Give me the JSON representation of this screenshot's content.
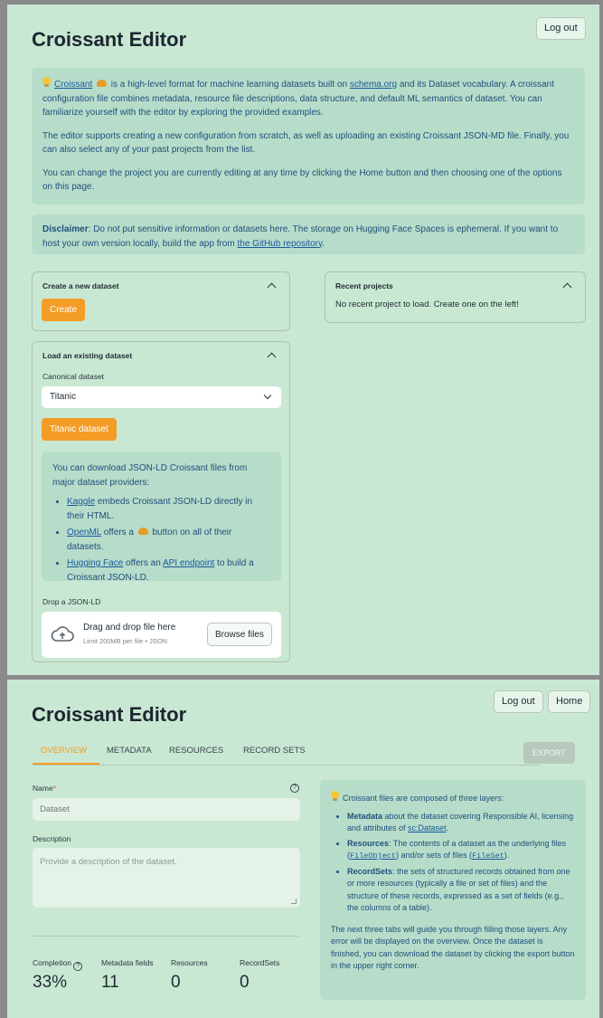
{
  "screen1": {
    "title": "Croissant Editor",
    "logout_label": "Log out",
    "intro": {
      "p1_link_croissant": "Croissant",
      "p1_a": " is a high-level format for machine learning datasets built on ",
      "p1_link_schema": "schema.org",
      "p1_b": " and its Dataset vocabulary. A croissant configuration file combines metadata, resource file descriptions, data structure, and default ML semantics of dataset. You can familiarize yourself with the editor by exploring the provided examples.",
      "p2": "The editor supports creating a new configuration from scratch, as well as uploading an existing Croissant JSON-MD file. Finally, you can also select any of your past projects from the list.",
      "p3": "You can change the project you are currently editing at any time by clicking the Home button and then choosing one of the options on this page."
    },
    "disclaimer": {
      "bold": "Disclaimer",
      "text": ": Do not put sensitive information or datasets here. The storage on Hugging Face Spaces is ephemeral. If you want to host your own version locally, build the app from ",
      "link": "the GitHub repository",
      "end": "."
    },
    "create_card": {
      "title": "Create a new dataset",
      "button": "Create"
    },
    "recent_card": {
      "title": "Recent projects",
      "empty": "No recent project to load. Create one on the left!"
    },
    "load_card": {
      "title": "Load an existing dataset",
      "canonical_label": "Canonical dataset",
      "selected": "Titanic",
      "button": "Titanic dataset",
      "info_intro": "You can download JSON-LD Croissant files from major dataset providers:",
      "items": [
        {
          "link": "Kaggle",
          "text": " embeds Croissant JSON-LD directly in their HTML."
        },
        {
          "link": "OpenML",
          "text_a": " offers a ",
          "text_b": " button on all of their datasets."
        },
        {
          "link": "Hugging Face",
          "text_a": " offers an ",
          "link2": "API endpoint",
          "text_b": " to build a Croissant JSON-LD."
        }
      ],
      "drop_label": "Drop a JSON-LD",
      "drop_main": "Drag and drop file here",
      "drop_sub": "Limit 200MB per file • JSON",
      "browse": "Browse files"
    }
  },
  "screen2": {
    "title": "Croissant Editor",
    "logout_label": "Log out",
    "home_label": "Home",
    "tabs": [
      "OVERVIEW",
      "METADATA",
      "RESOURCES",
      "RECORD SETS"
    ],
    "export_label": "EXPORT",
    "name_label": "Name",
    "name_required": "*",
    "name_placeholder": "Dataset",
    "description_label": "Description",
    "description_placeholder": "Provide a description of the dataset.",
    "metrics": [
      {
        "label": "Completion",
        "value": "33%"
      },
      {
        "label": "Metadata fields",
        "value": "11"
      },
      {
        "label": "Resources",
        "value": "0"
      },
      {
        "label": "RecordSets",
        "value": "0"
      }
    ],
    "info": {
      "heading": "Croissant files are composed of three layers:",
      "b1_bold": "Metadata",
      "b1_text": " about the dataset covering Responsible AI, licensing and attributes of ",
      "b1_link": "sc:Dataset",
      "b1_end": ".",
      "b2_bold": "Resources",
      "b2_text": ": The contents of a dataset as the underlying files (",
      "b2_code1": "FileObject",
      "b2_mid": ") and/or sets of files (",
      "b2_code2": "FileSet",
      "b2_end": ").",
      "b3_bold": "RecordSets",
      "b3_text": ": the sets of structured records obtained from one or more resources (typically a file or set of files) and the structure of these records, expressed as a set of fields (e.g., the columns of a table).",
      "footer": "The next three tabs will guide you through filling those layers. Any error will be displayed on the overview. Once the dataset is finished, you can download the dataset by clicking the export button in the upper right corner."
    }
  },
  "colors": {
    "background": "#c9e8d3",
    "accent": "#f39c26",
    "info_bg": "#b7dcca",
    "link": "#1a5a9c"
  }
}
